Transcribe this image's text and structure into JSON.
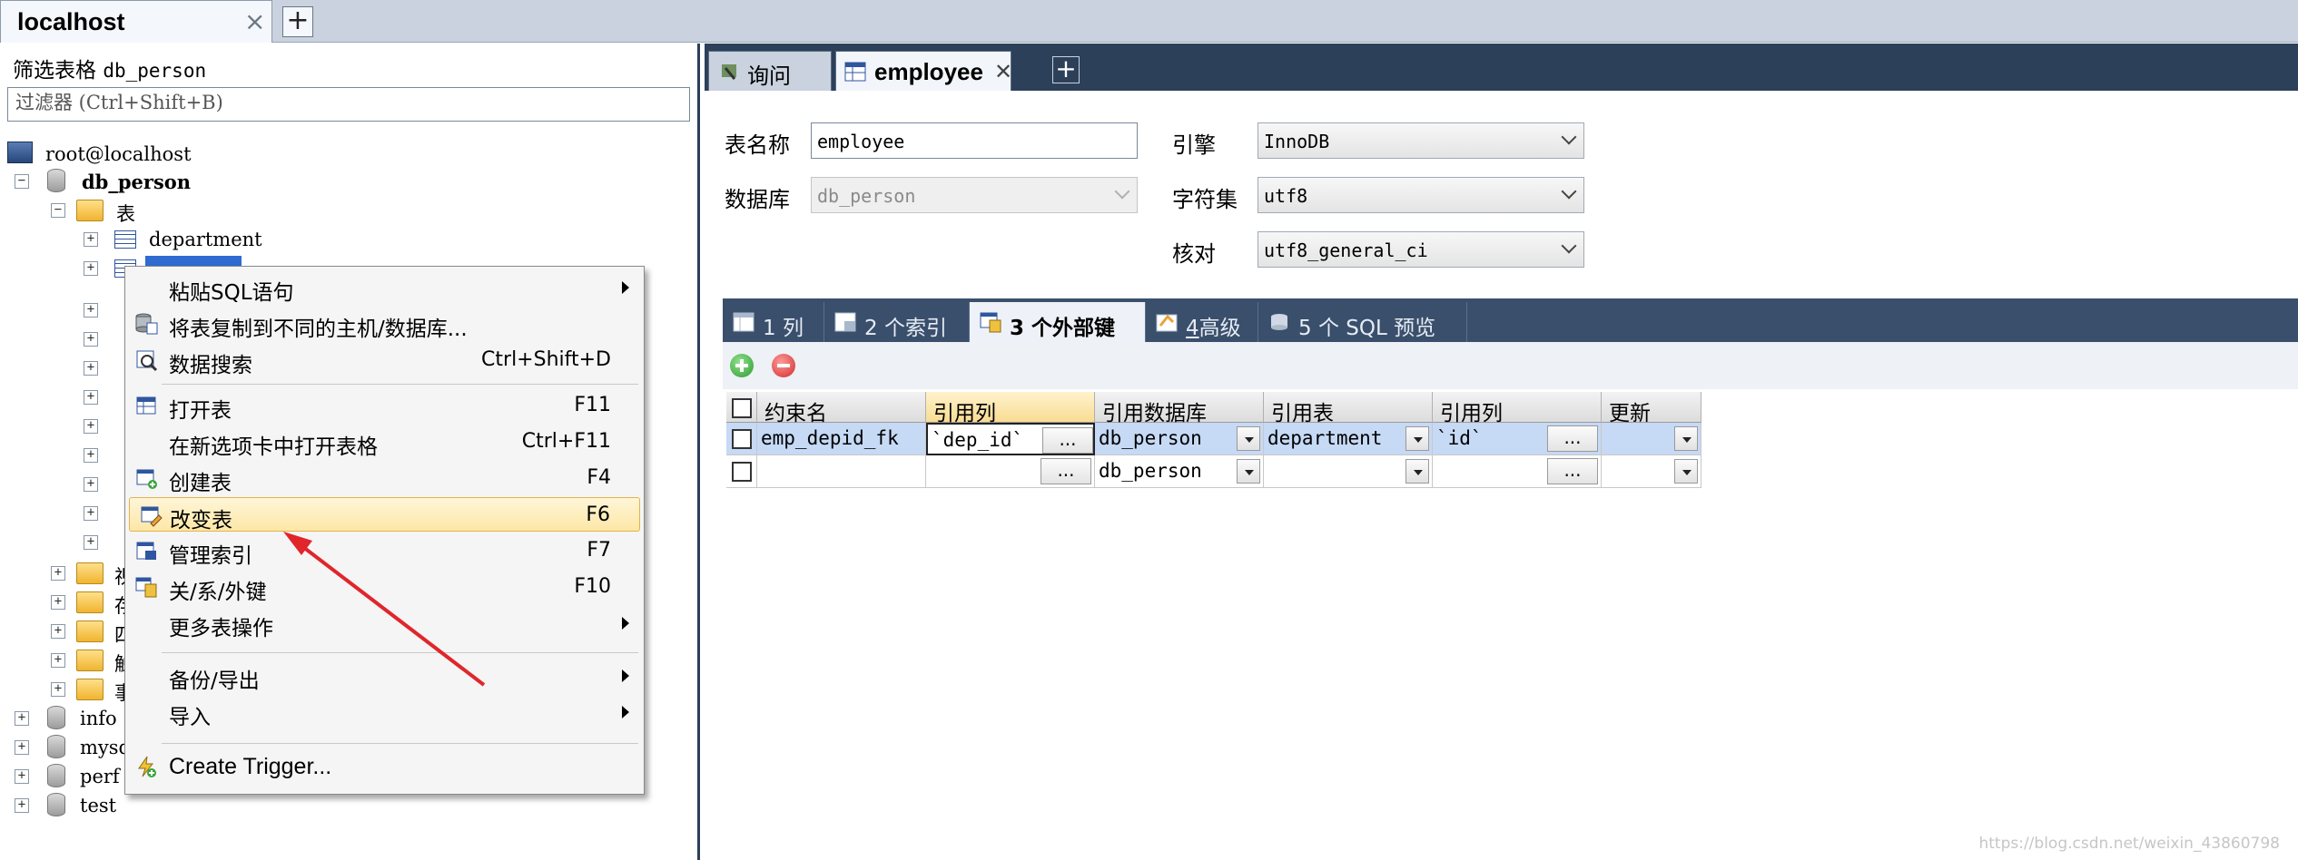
{
  "connection_tab": {
    "label": "localhost",
    "close": "×",
    "add": "+"
  },
  "left_panel": {
    "filter_label": "筛选表格",
    "filter_db": "db_person",
    "filter_placeholder": "过滤器 (Ctrl+Shift+B)",
    "tree": {
      "root": "root@localhost",
      "db": "db_person",
      "tables_folder": "表",
      "table_department": "department",
      "partial_folders": [
        "视",
        "存",
        "四",
        "触",
        "事"
      ],
      "other_dbs": [
        "info",
        "mysq",
        "perf",
        "test"
      ]
    }
  },
  "context_menu": {
    "items": [
      {
        "label": "粘贴SQL语句",
        "shortcut": "",
        "submenu": true,
        "icon": "paste-icon"
      },
      {
        "label": "将表复制到不同的主机/数据库...",
        "shortcut": "",
        "submenu": false,
        "icon": "copy-db-icon"
      },
      {
        "label": "数据搜索",
        "shortcut": "Ctrl+Shift+D",
        "submenu": false,
        "icon": "search-icon"
      },
      {
        "label": "打开表",
        "shortcut": "F11",
        "submenu": false,
        "icon": "table-icon"
      },
      {
        "label": "在新选项卡中打开表格",
        "shortcut": "Ctrl+F11",
        "submenu": false,
        "icon": ""
      },
      {
        "label": "创建表",
        "shortcut": "F4",
        "submenu": false,
        "icon": "create-table-icon"
      },
      {
        "label": "改变表",
        "shortcut": "F6",
        "submenu": false,
        "icon": "alter-table-icon"
      },
      {
        "label": "管理索引",
        "shortcut": "F7",
        "submenu": false,
        "icon": "index-icon"
      },
      {
        "label": "关/系/外键",
        "shortcut": "F10",
        "submenu": false,
        "icon": "foreign-key-icon"
      },
      {
        "label": "更多表操作",
        "shortcut": "",
        "submenu": true,
        "icon": ""
      },
      {
        "label": "备份/导出",
        "shortcut": "",
        "submenu": true,
        "icon": ""
      },
      {
        "label": "导入",
        "shortcut": "",
        "submenu": true,
        "icon": ""
      },
      {
        "label": "Create Trigger...",
        "shortcut": "",
        "submenu": false,
        "icon": "trigger-icon"
      }
    ]
  },
  "right_panel": {
    "tabs": [
      {
        "label": "询问"
      },
      {
        "label": "employee"
      }
    ],
    "form": {
      "table_name_label": "表名称",
      "table_name_value": "employee",
      "database_label": "数据库",
      "database_value": "db_person",
      "engine_label": "引擎",
      "engine_value": "InnoDB",
      "charset_label": "字符集",
      "charset_value": "utf8",
      "collation_label": "核对",
      "collation_value": "utf8_general_ci"
    },
    "subtabs": [
      {
        "num": "1",
        "label": "列"
      },
      {
        "num": "2",
        "label": "个索引"
      },
      {
        "num": "3",
        "label": "个外部键"
      },
      {
        "num": "4",
        "label": "高级"
      },
      {
        "num": "5",
        "label": "个 SQL 预览"
      }
    ],
    "grid": {
      "headers": [
        "约束名",
        "引用列",
        "引用数据库",
        "引用表",
        "引用列",
        "更新"
      ],
      "rows": [
        {
          "constraint": "emp_depid_fk",
          "ref_col": "`dep_id`",
          "ref_db": "db_person",
          "ref_table": "department",
          "ref_col2": "`id`",
          "update": ""
        },
        {
          "constraint": "",
          "ref_col": "",
          "ref_db": "db_person",
          "ref_table": "",
          "ref_col2": "",
          "update": ""
        }
      ],
      "ellipsis": "..."
    }
  },
  "watermark": "https://blog.csdn.net/weixin_43860798",
  "colors": {
    "annotation_arrow": "#e0262b",
    "menu_highlight": "#fde7a7",
    "selected_row": "#c6d9f5"
  }
}
